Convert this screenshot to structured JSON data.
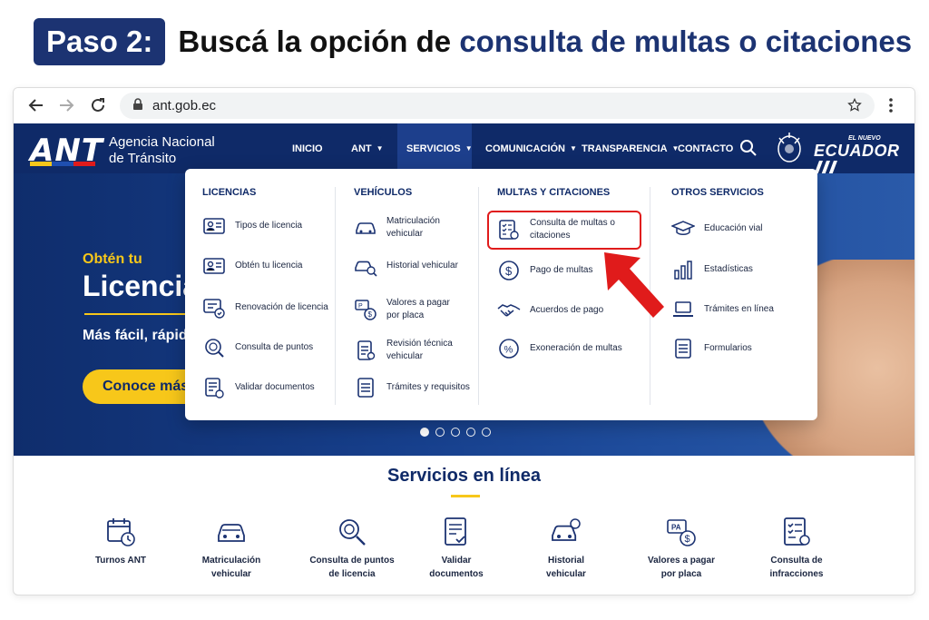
{
  "heading": {
    "step_badge": "Paso 2:",
    "title_prefix": "Buscá la opción de ",
    "title_highlight": "consulta de multas o citaciones"
  },
  "browser": {
    "url": "ant.gob.ec"
  },
  "site": {
    "logo": "ANT",
    "agency_line1": "Agencia Nacional",
    "agency_line2": "de Tránsito",
    "nav": [
      "INICIO",
      "ANT",
      "SERVICIOS",
      "COMUNICACIÓN",
      "TRANSPARENCIA",
      "CONTACTO"
    ],
    "ecuador_small": "EL NUEVO",
    "ecuador_big": "ECUADOR"
  },
  "hero": {
    "subtitle": "Obtén tu",
    "title": "Licencia",
    "text": "Más fácil, rápid",
    "button": "Conoce más"
  },
  "dropdown": {
    "licencias": {
      "title": "LICENCIAS",
      "items": [
        "Tipos de licencia",
        "Obtén tu licencia",
        "Renovación de licencia",
        "Consulta de puntos",
        "Validar documentos"
      ]
    },
    "vehiculos": {
      "title": "VEHÍCULOS",
      "items": [
        [
          "Matriculación",
          "vehicular"
        ],
        [
          "Historial vehicular",
          ""
        ],
        [
          "Valores a pagar",
          "por placa"
        ],
        [
          "Revisión técnica",
          "vehicular"
        ],
        [
          "Trámites y requisitos",
          ""
        ]
      ]
    },
    "multas": {
      "title": "MULTAS Y CITACIONES",
      "items": [
        [
          "Consulta de multas o",
          "citaciones"
        ],
        [
          "Pago de multas",
          ""
        ],
        [
          "Acuerdos de pago",
          ""
        ],
        [
          "Exoneración de multas",
          ""
        ]
      ]
    },
    "otros": {
      "title": "OTROS SERVICIOS",
      "items": [
        "Educación vial",
        "Estadísticas",
        "Trámites en línea",
        "Formularios"
      ]
    }
  },
  "services": {
    "title": "Servicios en línea",
    "items": [
      [
        "Turnos ANT",
        ""
      ],
      [
        "Matriculación",
        "vehicular"
      ],
      [
        "Consulta de puntos",
        "de licencia"
      ],
      [
        "Validar",
        "documentos"
      ],
      [
        "Historial",
        "vehicular"
      ],
      [
        "Valores a pagar",
        "por placa"
      ],
      [
        "Consulta de",
        "infracciones"
      ]
    ]
  },
  "colors": {
    "navy": "#0f2a68",
    "accent_yellow": "#f7c71a",
    "highlight_red": "#e01b1b"
  }
}
